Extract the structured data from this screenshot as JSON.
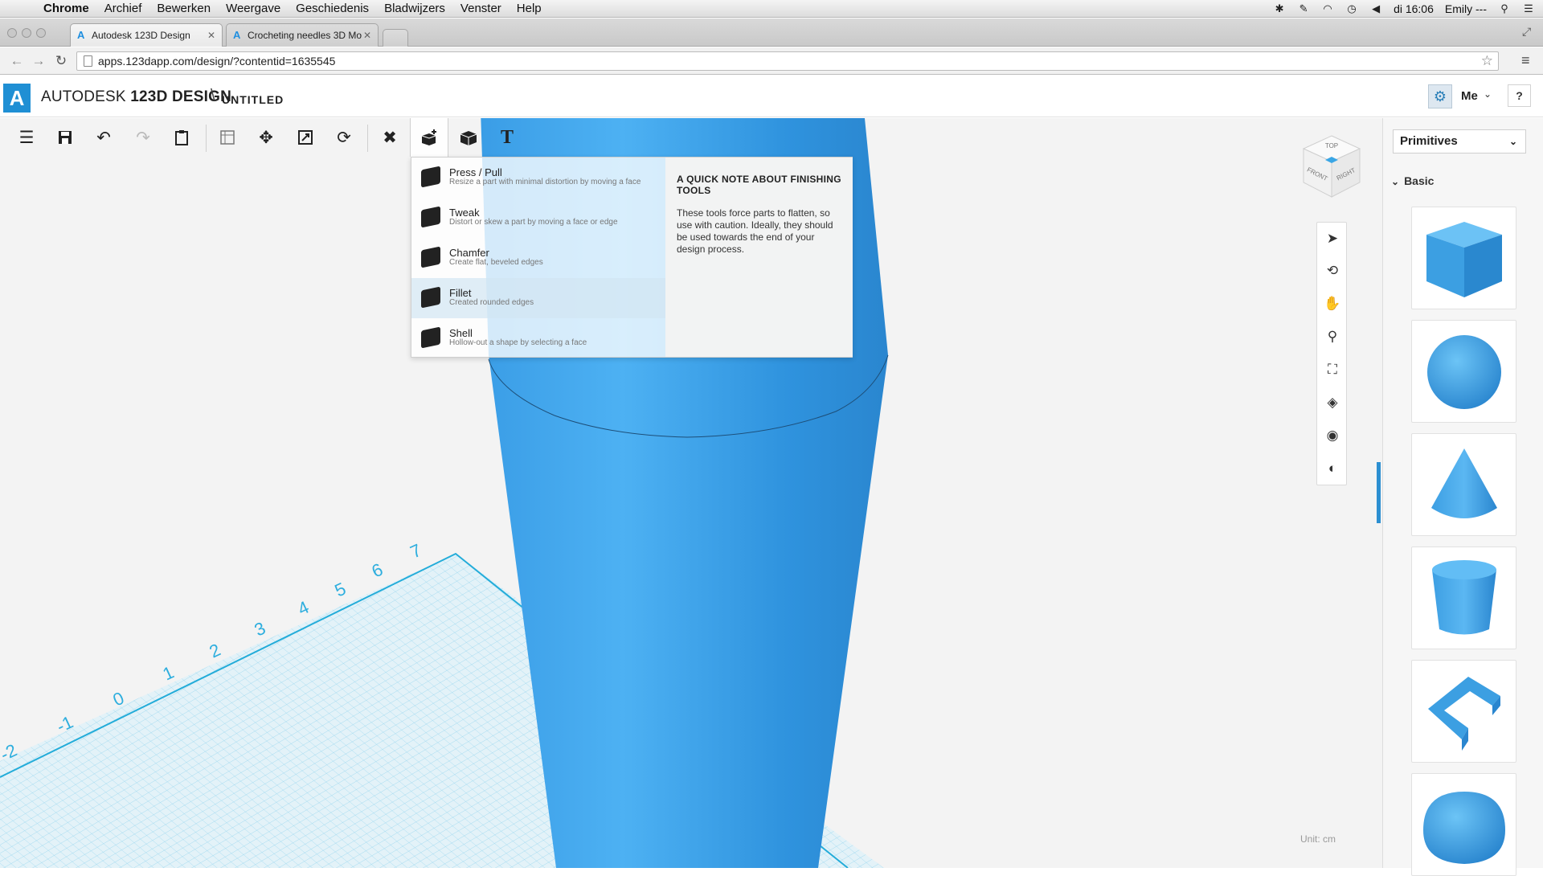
{
  "menubar": {
    "items": [
      "Chrome",
      "Archief",
      "Bewerken",
      "Weergave",
      "Geschiedenis",
      "Bladwijzers",
      "Venster",
      "Help"
    ],
    "clock": "di 16:06",
    "user": "Emily ---"
  },
  "browser": {
    "tabs": [
      {
        "title": "Autodesk 123D Design",
        "active": true
      },
      {
        "title": "Crocheting needles 3D Mo",
        "active": false
      }
    ],
    "url": "apps.123dapp.com/design/?contentid=1635545"
  },
  "app": {
    "brand_light": "AUTODESK",
    "brand_bold": "123D",
    "brand_design": "DESIGN",
    "doc_separator": "\\",
    "doc_title": "UNTITLED",
    "user_label": "Me",
    "help": "?"
  },
  "toolbar": {
    "text_tool": "T",
    "items": [
      "menu-icon",
      "save-icon",
      "undo-icon",
      "redo-icon",
      "clipboard-icon",
      "sketch-grid-icon",
      "move-icon",
      "scale-icon",
      "refresh-icon",
      "construct-icon",
      "modify-icon",
      "combine-icon",
      "text-icon"
    ]
  },
  "dropdown": {
    "items": [
      {
        "name": "Press / Pull",
        "desc": "Resize a part with minimal distortion by moving a face"
      },
      {
        "name": "Tweak",
        "desc": "Distort or skew a part by moving a face or edge"
      },
      {
        "name": "Chamfer",
        "desc": "Create flat, beveled edges"
      },
      {
        "name": "Fillet",
        "desc": "Created rounded edges"
      },
      {
        "name": "Shell",
        "desc": "Hollow-out a shape by selecting a face"
      }
    ],
    "note_title": "A QUICK NOTE ABOUT FINISHING TOOLS",
    "note_body": "These tools force parts to flatten, so use with caution. Ideally, they should be used towards the end of your design process."
  },
  "viewcube": {
    "top": "TOP",
    "front": "FRONT",
    "right": "RIGHT"
  },
  "nav_tools": [
    "select-icon",
    "orbit-icon",
    "pan-icon",
    "zoom-icon",
    "fit-icon",
    "zoom-selected-icon",
    "visibility-icon",
    "material-icon"
  ],
  "grid": {
    "labels": [
      "7",
      "6",
      "5",
      "4",
      "3",
      "2",
      "1",
      "0",
      "-1",
      "-2"
    ]
  },
  "unit_label": "Unit:  cm",
  "panel": {
    "selector": "Primitives",
    "section": "Basic",
    "primitives": [
      "box",
      "sphere",
      "cone",
      "cylinder",
      "polygon-profile",
      "hemisphere"
    ]
  },
  "colors": {
    "accent": "#1f8fd4",
    "model": "#4aaff0",
    "grid_line": "#33b5e0"
  }
}
